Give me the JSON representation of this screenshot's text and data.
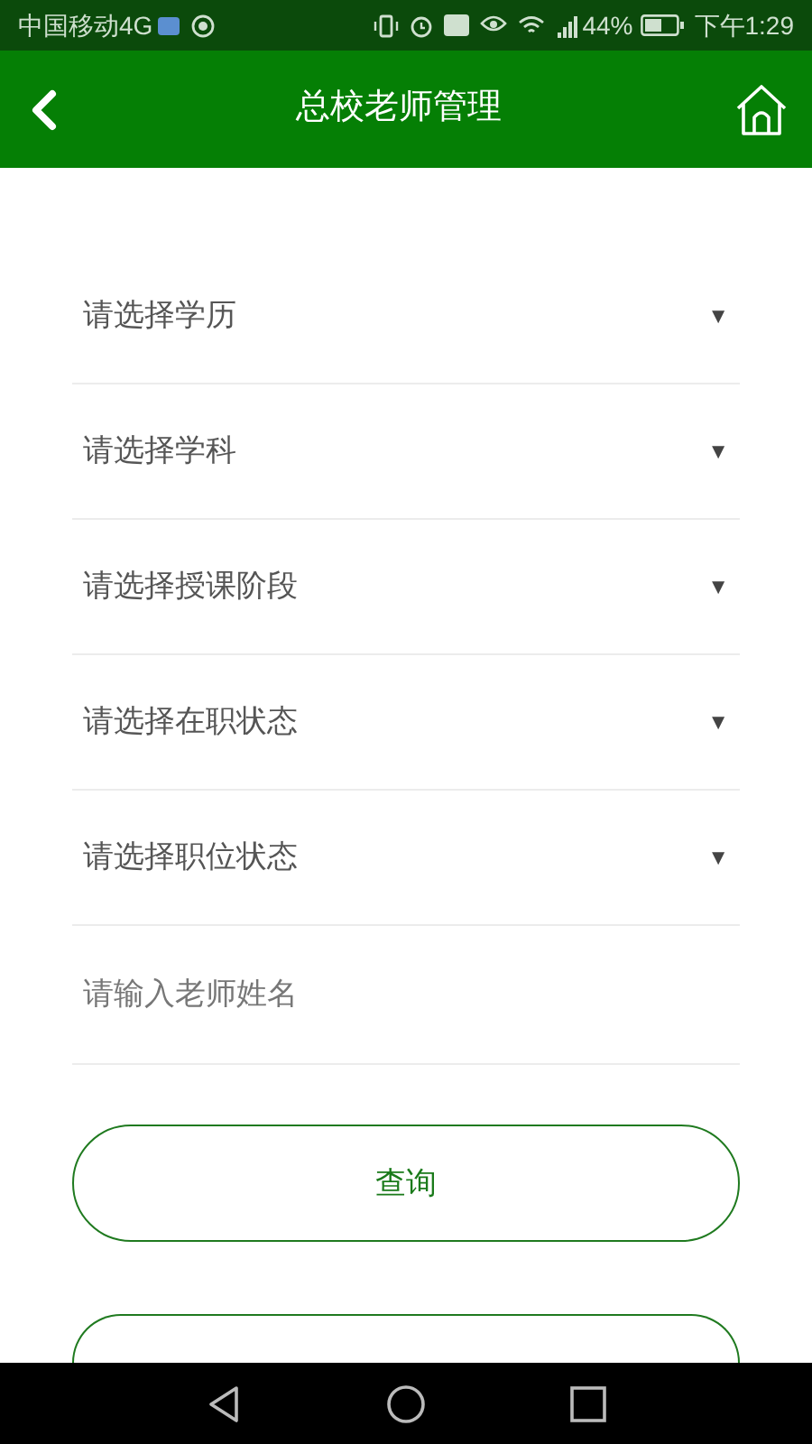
{
  "status_bar": {
    "carrier": "中国移动4G",
    "battery": "44%",
    "time": "下午1:29"
  },
  "header": {
    "title": "总校老师管理"
  },
  "filters": [
    {
      "kind": "select",
      "placeholder": "请选择学历"
    },
    {
      "kind": "select",
      "placeholder": "请选择学科"
    },
    {
      "kind": "select",
      "placeholder": "请选择授课阶段"
    },
    {
      "kind": "select",
      "placeholder": "请选择在职状态"
    },
    {
      "kind": "select",
      "placeholder": "请选择职位状态"
    },
    {
      "kind": "input",
      "placeholder": "请输入老师姓名"
    }
  ],
  "dropdown_glyph": "▼",
  "buttons": [
    "查询"
  ],
  "more_buttons_below": true
}
